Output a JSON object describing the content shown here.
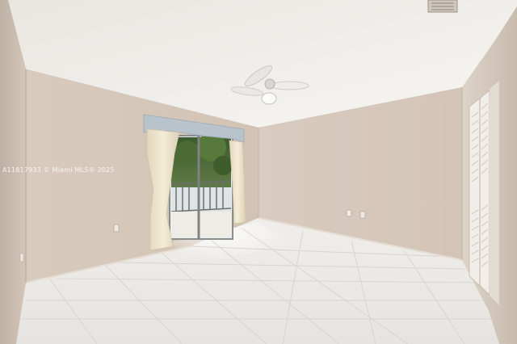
{
  "photo": {
    "watermark": "A11817933 © Miami MLS® 2025"
  },
  "colors": {
    "ceiling": "#f1efeb",
    "wall_left": "#d6c8ba",
    "wall_back": "#d9ccc0",
    "wall_right": "#cfc2b5",
    "floor": "#ecebe8",
    "curtain": "#f0e6cf",
    "valance": "#b8c2cc"
  }
}
